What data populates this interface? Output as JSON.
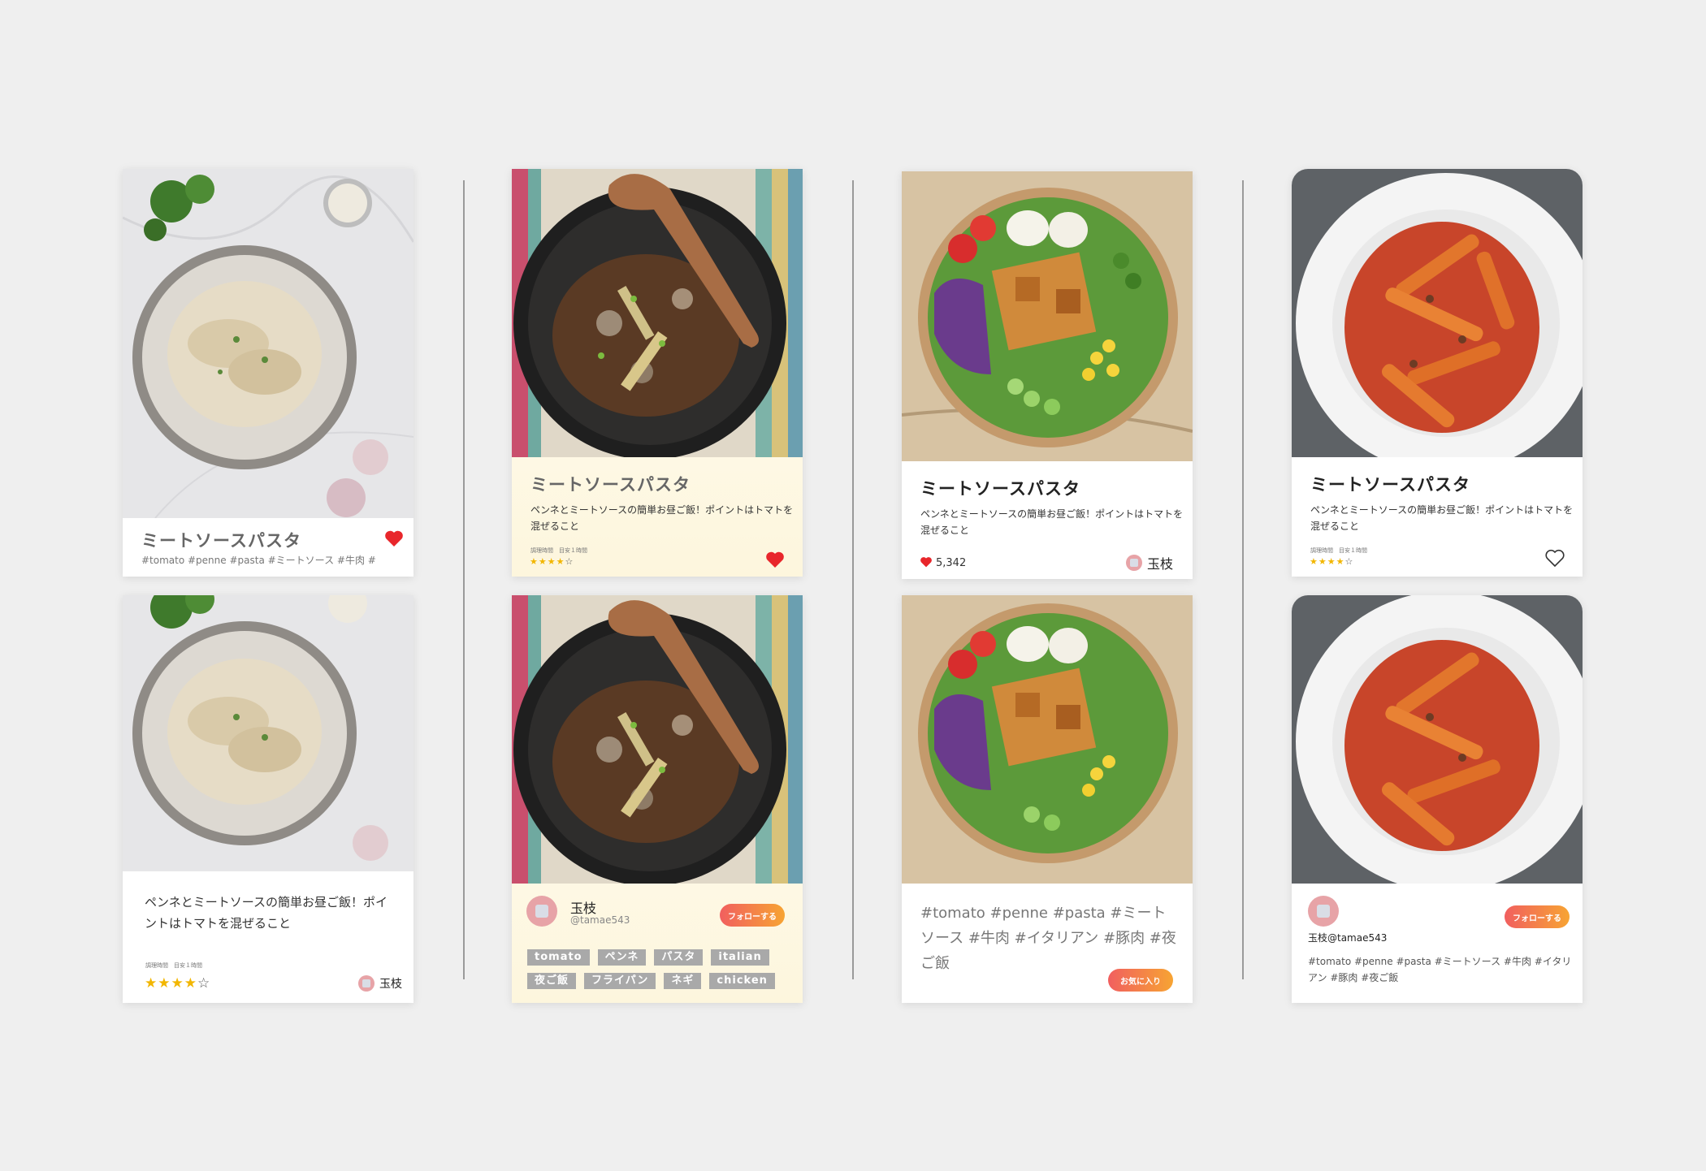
{
  "recipe": {
    "title": "ミートソースパスタ",
    "description": "ペンネとミートソースの簡単お昼ご飯！ポイントはトマトを混ぜること",
    "tags_short": "#tomato #penne #pasta #ミートソース #牛肉 #",
    "tags_full": "#tomato #penne #pasta #ミートソース #牛肉 #イタリアン #豚肉 #夜ご飯",
    "cook_time": "調理時間　目安１時間",
    "rating_filled": "★★★★",
    "rating_empty": "☆",
    "likes": "5,342"
  },
  "user": {
    "name": "玉枝",
    "handle": "@tamae543",
    "name_handle": "玉枝@tamae543"
  },
  "buttons": {
    "follow": "フォローする",
    "favorite": "お気に入り"
  },
  "chips": [
    "tomato",
    "ペンネ",
    "パスタ",
    "italian",
    "夜ご飯",
    "フライパン",
    "ネギ",
    "chicken"
  ],
  "colors": {
    "heart": "#e8262b",
    "star": "#f2b600",
    "gradient_start": "#f15f5f",
    "gradient_end": "#f7a433"
  },
  "icons": [
    "heart-filled-icon",
    "heart-outline-icon",
    "avatar-icon",
    "star-icon"
  ]
}
